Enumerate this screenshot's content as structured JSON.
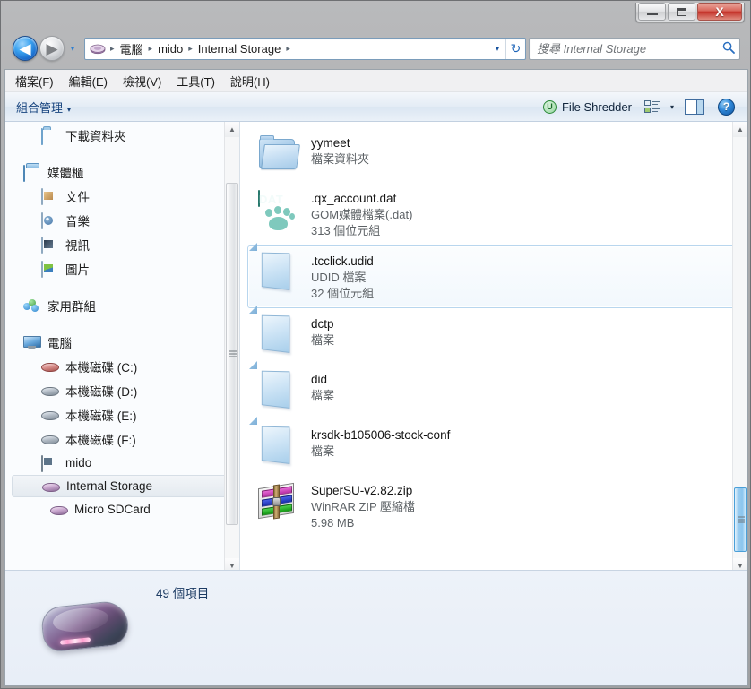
{
  "window": {
    "controls": {
      "minimize_label": "Minimize",
      "maximize_label": "Maximize",
      "close_label": "X"
    }
  },
  "nav": {
    "back_label": "◀",
    "forward_label": "▶",
    "history_label": "▾",
    "refresh_label": "↻",
    "breadcrumb_dropdown": "▾",
    "breadcrumb": [
      {
        "label": "電腦",
        "sep": "▸"
      },
      {
        "label": "mido",
        "sep": "▸"
      },
      {
        "label": "Internal Storage",
        "sep": "▸"
      }
    ]
  },
  "search": {
    "placeholder": "搜尋 Internal Storage",
    "value": "",
    "icon_label": "🔍"
  },
  "menubar": {
    "items": [
      {
        "text": "檔案(F)"
      },
      {
        "text": "編輯(E)"
      },
      {
        "text": "檢視(V)"
      },
      {
        "text": "工具(T)"
      },
      {
        "text": "說明(H)"
      }
    ]
  },
  "commandbar": {
    "organize_label": "組合管理",
    "organize_caret": "▾",
    "shredder_label": "File Shredder",
    "shredder_icon_text": "U",
    "view_caret": "▾",
    "help_label": "?"
  },
  "sidebar": {
    "items": [
      {
        "label": "下載資料夾",
        "icon": "folder-icon",
        "level": 2,
        "gap": false,
        "selected": false
      },
      {
        "label": "媒體櫃",
        "icon": "library-icon",
        "level": 1,
        "gap": true,
        "selected": false
      },
      {
        "label": "文件",
        "icon": "documents-icon",
        "level": 2,
        "gap": false,
        "selected": false
      },
      {
        "label": "音樂",
        "icon": "music-icon",
        "level": 2,
        "gap": false,
        "selected": false
      },
      {
        "label": "視訊",
        "icon": "video-icon",
        "level": 2,
        "gap": false,
        "selected": false
      },
      {
        "label": "圖片",
        "icon": "pictures-icon",
        "level": 2,
        "gap": false,
        "selected": false
      },
      {
        "label": "家用群組",
        "icon": "homegroup-icon",
        "level": 1,
        "gap": true,
        "selected": false
      },
      {
        "label": "電腦",
        "icon": "computer-icon",
        "level": 1,
        "gap": true,
        "selected": false
      },
      {
        "label": "本機磁碟 (C:)",
        "icon": "harddisk-c-icon",
        "level": 2,
        "gap": false,
        "selected": false
      },
      {
        "label": "本機磁碟 (D:)",
        "icon": "harddisk-icon",
        "level": 2,
        "gap": false,
        "selected": false
      },
      {
        "label": "本機磁碟 (E:)",
        "icon": "harddisk-icon",
        "level": 2,
        "gap": false,
        "selected": false
      },
      {
        "label": "本機磁碟 (F:)",
        "icon": "harddisk-icon",
        "level": 2,
        "gap": false,
        "selected": false
      },
      {
        "label": "mido",
        "icon": "phone-icon",
        "level": 2,
        "gap": false,
        "selected": false
      },
      {
        "label": "Internal Storage",
        "icon": "removable-drive-icon",
        "level": 3,
        "gap": false,
        "selected": true
      },
      {
        "label": "Micro SDCard",
        "icon": "removable-drive-icon",
        "level": 3,
        "gap": false,
        "selected": false
      }
    ]
  },
  "files": {
    "items": [
      {
        "name": "yymeet",
        "type": "檔案資料夾",
        "size": "",
        "icon": "folder-icon",
        "selected": false
      },
      {
        "name": ".qx_account.dat",
        "type": "GOM媒體檔案(.dat)",
        "size": "313 個位元組",
        "icon": "dat-file-icon",
        "selected": false
      },
      {
        "name": ".tcclick.udid",
        "type": "UDID 檔案",
        "size": "32 個位元組",
        "icon": "generic-file-icon",
        "selected": true
      },
      {
        "name": "dctp",
        "type": "檔案",
        "size": "",
        "icon": "generic-file-icon",
        "selected": false
      },
      {
        "name": "did",
        "type": "檔案",
        "size": "",
        "icon": "generic-file-icon",
        "selected": false
      },
      {
        "name": "krsdk-b105006-stock-conf",
        "type": "檔案",
        "size": "",
        "icon": "generic-file-icon",
        "selected": false
      },
      {
        "name": "SuperSU-v2.82.zip",
        "type": "WinRAR ZIP 壓縮檔",
        "size": "5.98 MB",
        "icon": "zip-archive-icon",
        "selected": false
      }
    ]
  },
  "details_pane": {
    "status_text": "49 個項目",
    "icon": "removable-drive-large-icon"
  },
  "scrollbars": {
    "up_arrow": "▲",
    "down_arrow": "▼"
  },
  "colors": {
    "accent": "#2f7fd0",
    "selection_border": "#b8d6ee",
    "title_close": "#c4332a",
    "dat_icon": "#2f9486"
  }
}
